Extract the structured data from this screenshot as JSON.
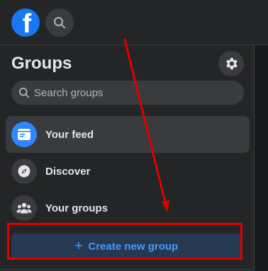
{
  "topbar": {
    "logo_letter": "f",
    "search_icon": "search-icon"
  },
  "sidebar": {
    "title": "Groups",
    "settings_icon": "gear-icon",
    "search": {
      "placeholder": "Search groups",
      "value": ""
    },
    "items": [
      {
        "label": "Your feed",
        "icon": "feed-icon",
        "active": true
      },
      {
        "label": "Discover",
        "icon": "compass-icon",
        "active": false
      },
      {
        "label": "Your groups",
        "icon": "groups-icon",
        "active": false
      }
    ],
    "create_button": {
      "plus": "+",
      "label": "Create new group"
    }
  },
  "colors": {
    "accent": "#1877f2",
    "button_text": "#4599ff",
    "button_bg": "#263951",
    "annotation": "#e00000",
    "background": "#18191a",
    "panel": "#242526"
  }
}
